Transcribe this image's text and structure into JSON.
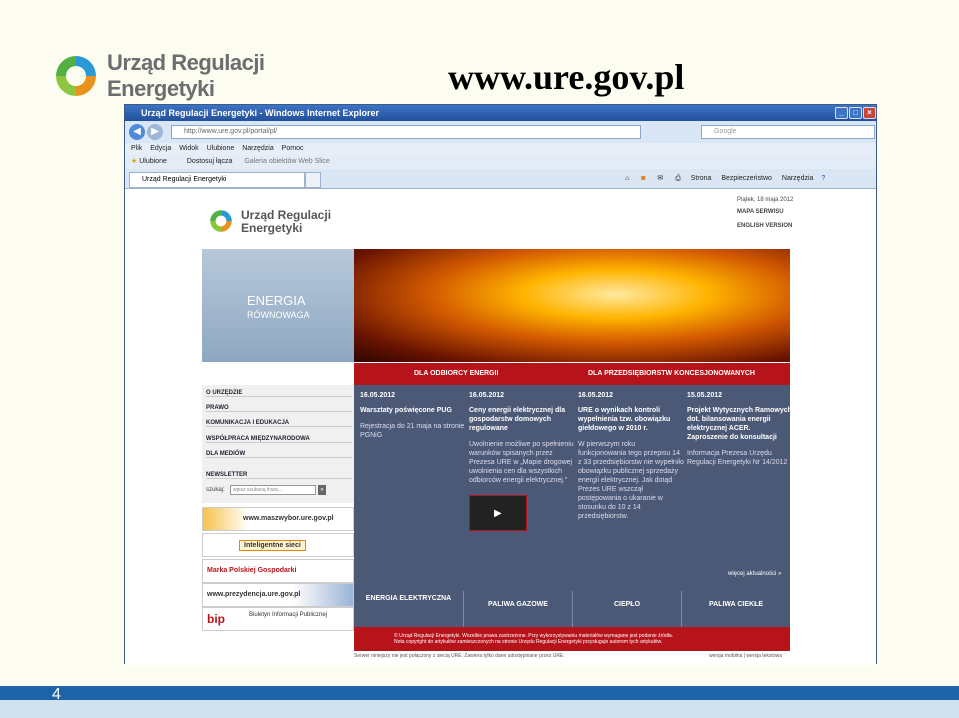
{
  "slide": {
    "logo_line1": "Urząd Regulacji",
    "logo_line2": "Energetyki",
    "title": "www.ure.gov.pl",
    "page_number": "4"
  },
  "browser": {
    "title": "Urząd Regulacji Energetyki - Windows Internet Explorer",
    "url": "http://www.ure.gov.pl/portal/pl/",
    "search_placeholder": "Google",
    "menu": [
      "Plik",
      "Edycja",
      "Widok",
      "Ulubione",
      "Narzędzia",
      "Pomoc"
    ],
    "favorites": [
      "Ulubione",
      "Dostosuj łącza",
      "Galeria obiektów Web Slice"
    ],
    "tab_label": "Urząd Regulacji Energetyki",
    "tools": [
      "Strona",
      "Bezpieczeństwo",
      "Narzędzia"
    ]
  },
  "site": {
    "logo_line1": "Urząd Regulacji",
    "logo_line2": "Energetyki",
    "date": "Piątek, 18 maja 2012",
    "map": "MAPA SERWISU",
    "english": "ENGLISH VERSION",
    "hero_line1": "ENERGIA",
    "hero_line2": "RÓWNOWAGA",
    "tab_consumers": "DLA ODBIORCY ENERGII",
    "tab_companies": "DLA PRZEDSIĘBIORSTW KONCESJONOWANYCH",
    "nav": [
      "O URZĘDZIE",
      "PRAWO",
      "KOMUNIKACJA I EDUKACJA",
      "WSPÓŁPRACA MIĘDZYNARODOWA",
      "DLA MEDIÓW",
      "NEWSLETTER"
    ],
    "search_label": "szukaj:",
    "search_placeholder": "wpisz szukaną frazę...",
    "banners": [
      "www.maszwybor.ure.gov.pl",
      "Inteligentne sieci",
      "Marka Polskiej Gospodarki",
      "www.prezydencja.ure.gov.pl",
      "Biuletyn Informacji Publicznej"
    ],
    "news": [
      {
        "date": "16.05.2012",
        "head": "Warsztaty poświęcone PUG",
        "body": "Rejestracja do 21 maja na stronie PGNiG"
      },
      {
        "date": "16.05.2012",
        "head": "Ceny energii elektrycznej dla gospodarstw domowych regulowane",
        "body": "Uwolnienie możliwe po spełnieniu warunków spisanych przez Prezesa URE w „Mapie drogowej uwolnienia cen dla wszystkich odbiorców energii elektrycznej.”"
      },
      {
        "date": "16.05.2012",
        "head": "URE o wynikach kontroli wypełnienia tzw. obowiązku giełdowego w 2010 r.",
        "body": "W pierwszym roku funkcjonowania tego przepisu 14 z 33 przedsiębiorstw nie wypełniło obowiązku publicznej sprzedaży energii elektrycznej. Jak dotąd Prezes URE wszczął postępowania o ukaranie w stosunku do 10 z 14 przedsiębiorstw."
      },
      {
        "date": "15.05.2012",
        "head": "Projekt Wytycznych Ramowych dot. bilansowania energii elektrycznej ACER. Zaproszenie do konsultacji",
        "body": "Informacja Prezesa Urzędu Regulacji Energetyki Nr 14/2012"
      }
    ],
    "more_news": "więcej aktualności »",
    "tiles": [
      "ENERGIA ELEKTRYCZNA",
      "PALIWA GAZOWE",
      "CIEPŁO",
      "PALIWA CIEKŁE"
    ],
    "footer": "© Urząd Regulacji Energetyki. Wszelkie prawa zastrzeżone. Przy wykorzystywaniu materiałów wymagane jest podanie źródła.",
    "footer2": "Nota copyright do artykułów zamieszczonych na stronie Urzędu Regulacji Energetyki przysługuje autorom tych artykułów.",
    "status": "Serwer niniejszy nie jest połączony z siecią URE. Zawiera tylko dane udostępniane przez URE.",
    "mobile": "wersja mobilna | wersja tekstowa"
  }
}
